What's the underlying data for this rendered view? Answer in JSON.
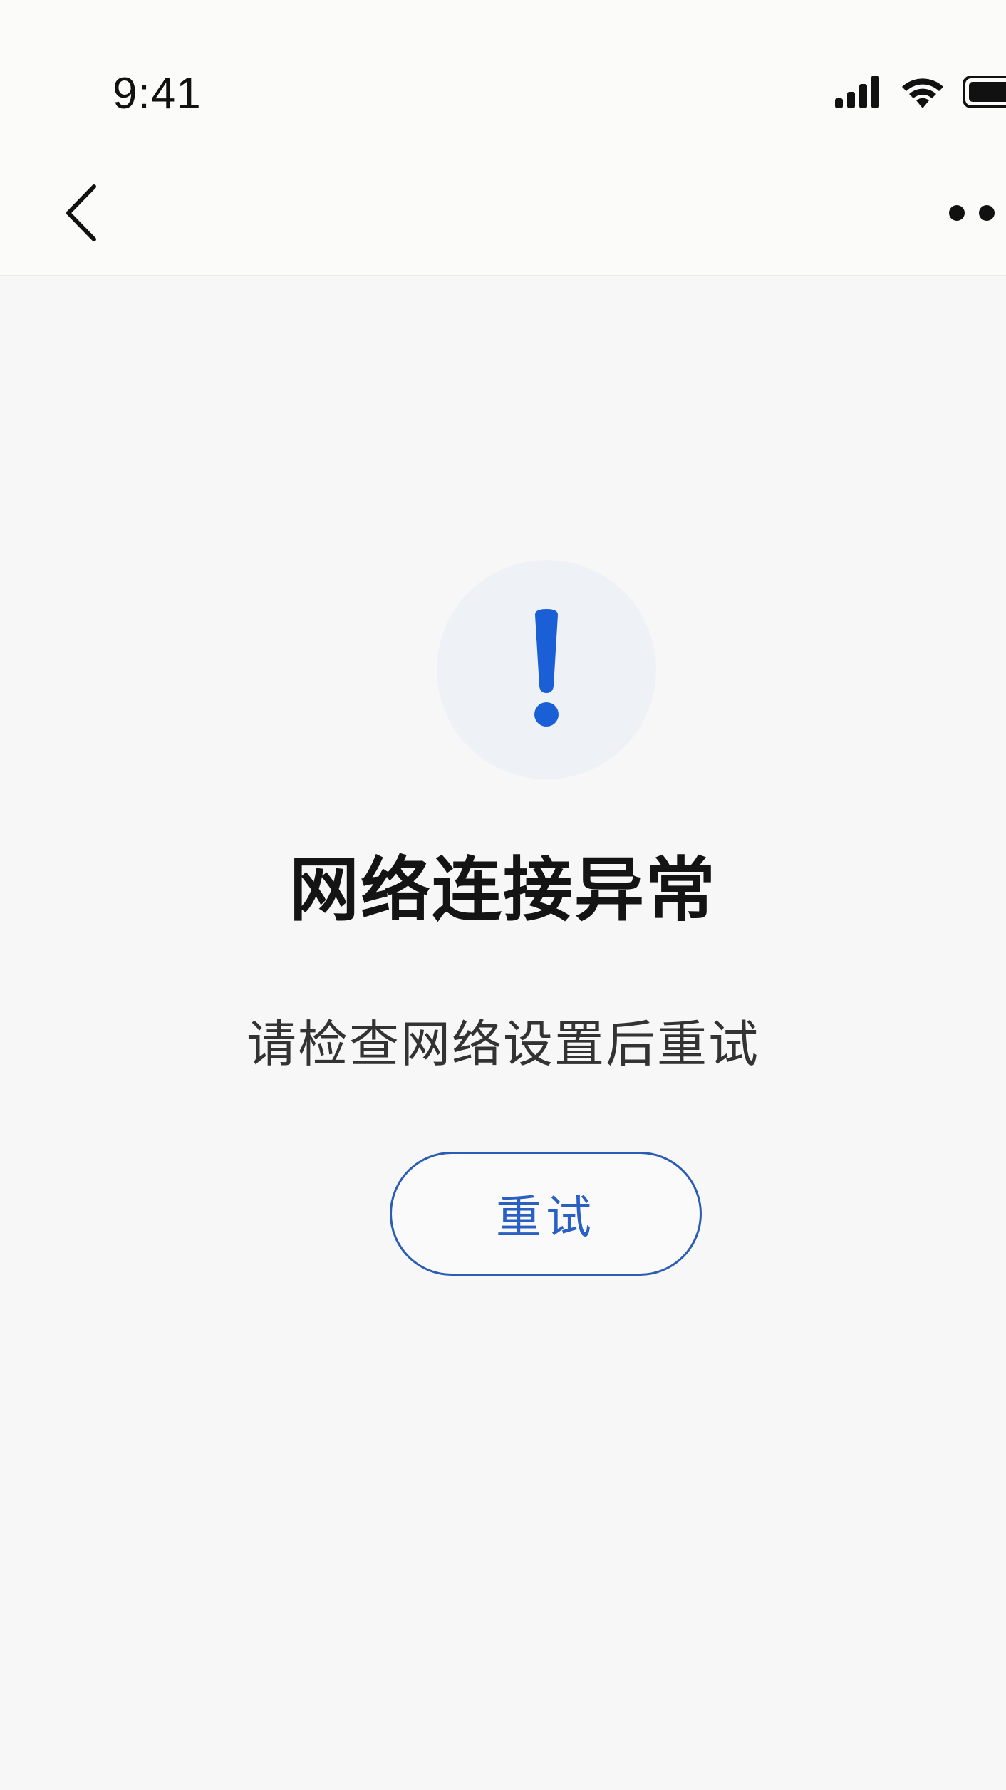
{
  "status_bar": {
    "time": "9:41",
    "icons": [
      "signal-icon",
      "wifi-icon",
      "battery-icon"
    ]
  },
  "nav_bar": {
    "back_icon": "chevron-left-icon",
    "more_icon": "more-dots-icon"
  },
  "error": {
    "icon": "exclamation-icon",
    "title": "网络连接异常",
    "subtitle": "请检查网络设置后重试",
    "retry_label": "重试"
  },
  "colors": {
    "accent": "#1a5fd6",
    "icon_bg": "#eef2f7",
    "background": "#f7f7f7"
  }
}
